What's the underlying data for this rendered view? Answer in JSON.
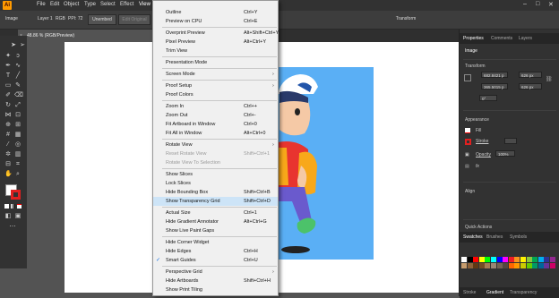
{
  "app": {
    "logo": "Ai"
  },
  "menubar": [
    "File",
    "Edit",
    "Object",
    "Type",
    "Select",
    "Effect",
    "View"
  ],
  "controlbar": {
    "doc_label": "Image",
    "layer": "Layer 1",
    "rgb": "RGB",
    "ppi": "PPI: 72",
    "unembed": "Unembed",
    "edit_original": "Edit Original",
    "transform": "Transform"
  },
  "document_tab": {
    "close": "×",
    "title": "48.86 % (RGB/Preview)"
  },
  "view_menu": {
    "items": [
      {
        "label": "Outline",
        "shortcut": "Ctrl+Y"
      },
      {
        "label": "Preview on CPU",
        "shortcut": "Ctrl+E"
      },
      {
        "sep": true
      },
      {
        "label": "Overprint Preview",
        "shortcut": "Alt+Shift+Ctrl+Y"
      },
      {
        "label": "Pixel Preview",
        "shortcut": "Alt+Ctrl+Y"
      },
      {
        "label": "Trim View",
        "shortcut": ""
      },
      {
        "sep": true
      },
      {
        "label": "Presentation Mode",
        "shortcut": ""
      },
      {
        "sep": true
      },
      {
        "label": "Screen Mode",
        "shortcut": "",
        "submenu": true
      },
      {
        "sep": true
      },
      {
        "label": "Proof Setup",
        "shortcut": "",
        "submenu": true
      },
      {
        "label": "Proof Colors",
        "shortcut": ""
      },
      {
        "sep": true
      },
      {
        "label": "Zoom In",
        "shortcut": "Ctrl++"
      },
      {
        "label": "Zoom Out",
        "shortcut": "Ctrl+-"
      },
      {
        "label": "Fit Artboard in Window",
        "shortcut": "Ctrl+0"
      },
      {
        "label": "Fit All in Window",
        "shortcut": "Alt+Ctrl+0"
      },
      {
        "sep": true
      },
      {
        "label": "Rotate View",
        "shortcut": "",
        "submenu": true
      },
      {
        "label": "Reset Rotate View",
        "shortcut": "Shift+Ctrl+1",
        "disabled": true
      },
      {
        "label": "Rotate View To Selection",
        "shortcut": "",
        "disabled": true
      },
      {
        "sep": true
      },
      {
        "label": "Show Slices",
        "shortcut": ""
      },
      {
        "label": "Lock Slices",
        "shortcut": ""
      },
      {
        "label": "Hide Bounding Box",
        "shortcut": "Shift+Ctrl+B"
      },
      {
        "label": "Show Transparency Grid",
        "shortcut": "Shift+Ctrl+D",
        "highlighted": true
      },
      {
        "sep": true
      },
      {
        "label": "Actual Size",
        "shortcut": "Ctrl+1"
      },
      {
        "label": "Hide Gradient Annotator",
        "shortcut": "Alt+Ctrl+G"
      },
      {
        "label": "Show Live Paint Gaps",
        "shortcut": ""
      },
      {
        "sep": true
      },
      {
        "label": "Hide Corner Widget",
        "shortcut": ""
      },
      {
        "label": "Hide Edges",
        "shortcut": "Ctrl+H"
      },
      {
        "label": "Smart Guides",
        "shortcut": "Ctrl+U",
        "checked": true
      },
      {
        "sep": true
      },
      {
        "label": "Perspective Grid",
        "shortcut": "",
        "submenu": true
      },
      {
        "label": "Hide Artboards",
        "shortcut": "Shift+Ctrl+H"
      },
      {
        "label": "Show Print Tiling",
        "shortcut": ""
      }
    ],
    "check_glyph": "✓",
    "submenu_glyph": "›"
  },
  "right_panel": {
    "tabs": [
      "Properties",
      "Comments",
      "Layers"
    ],
    "section_image": "Image",
    "transform_title": "Transform",
    "x_value": "682.8421 p",
    "y_value": "365.5015 p",
    "w_value": "626 px",
    "h_value": "626 px",
    "angle": "0°",
    "appearance_title": "Appearance",
    "fill_label": "Fill",
    "stroke_label": "Stroke",
    "opacity_label": "Opacity",
    "opacity_value": "100%",
    "fx": "fx",
    "align_title": "Align",
    "quick_actions": "Quick Actions",
    "swatch_tabs": [
      "Swatches",
      "Brushes",
      "Symbols"
    ],
    "bottom_tabs": [
      "Stroke",
      "Gradient",
      "Transparency"
    ],
    "swatch_colors": [
      "#ffffff",
      "#000000",
      "#ff0000",
      "#ffff00",
      "#00ff00",
      "#00ffff",
      "#0000ff",
      "#ff00ff",
      "#ee1d24",
      "#f7941d",
      "#fff200",
      "#8dc63f",
      "#00a651",
      "#00aeef",
      "#2e3192",
      "#92278f",
      "#c69c6d",
      "#8c6239",
      "#603913",
      "#754c24",
      "#a67c52",
      "#998675",
      "#736357",
      "#534741",
      "#ff6600",
      "#ff9900",
      "#cccc00",
      "#66cc00",
      "#009966",
      "#006699",
      "#663399",
      "#cc0066"
    ]
  }
}
